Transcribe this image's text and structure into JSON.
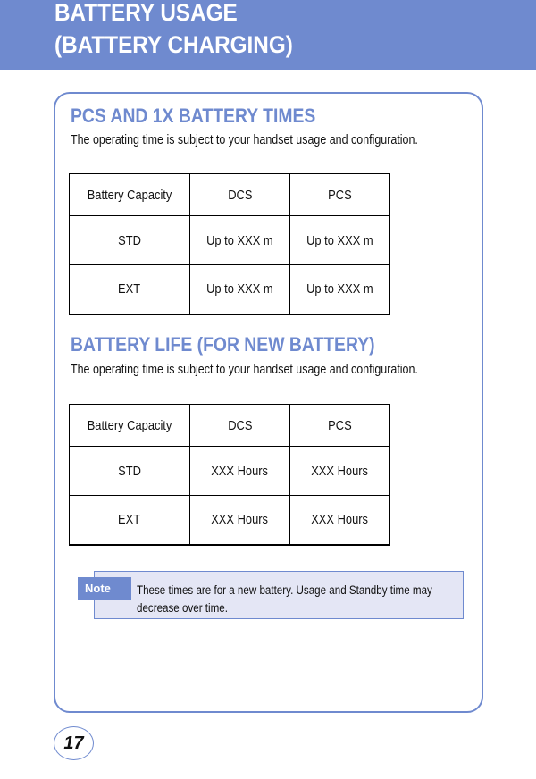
{
  "header": {
    "line1": "BATTERY USAGE",
    "line2": "(BATTERY CHARGING)"
  },
  "section1": {
    "title": "PCS AND 1X BATTERY TIMES",
    "subtitle": "The operating time is subject to your handset usage and configuration.",
    "headers": [
      "Battery Capacity",
      "DCS",
      "PCS"
    ],
    "rows": [
      [
        "STD",
        "Up to XXX m",
        "Up to XXX m"
      ],
      [
        "EXT",
        "Up to XXX m",
        "Up to XXX m"
      ]
    ]
  },
  "section2": {
    "title": "BATTERY LIFE (FOR NEW BATTERY)",
    "subtitle": "The operating time is subject to your handset usage and configuration.",
    "headers": [
      "Battery Capacity",
      "DCS",
      "PCS"
    ],
    "rows": [
      [
        "STD",
        "XXX Hours",
        "XXX Hours"
      ],
      [
        "EXT",
        "XXX Hours",
        "XXX Hours"
      ]
    ]
  },
  "note": {
    "label": "Note",
    "text": "These times are for a new battery. Usage and Standby time may decrease over time."
  },
  "page_number": "17",
  "colors": {
    "accent": "#6f8acf",
    "note_bg": "#e4e6f5"
  }
}
